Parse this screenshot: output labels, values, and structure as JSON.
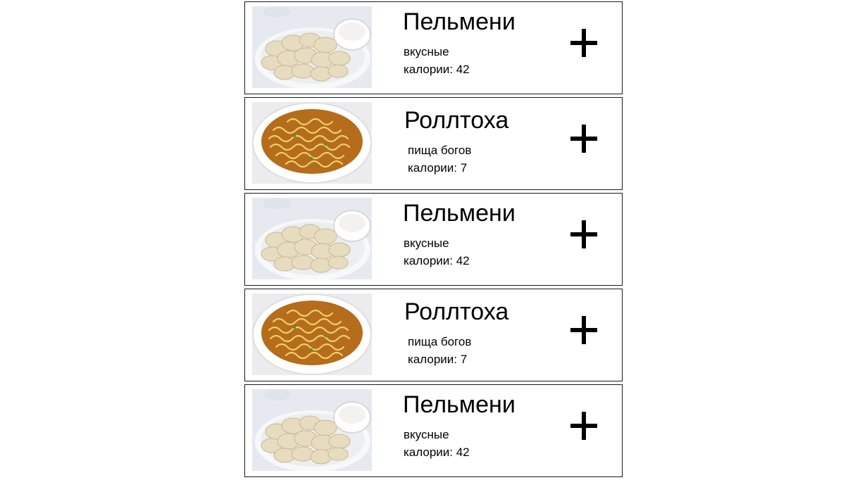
{
  "menu": {
    "items": [
      {
        "image": "pelmeni-photo",
        "title": "Пельмени",
        "description": "вкусные",
        "calories": "калории: 42",
        "add_icon": "plus-icon"
      },
      {
        "image": "noodles-photo",
        "title": "Роллтоха",
        "description": "пища богов",
        "calories": "калории: 7",
        "add_icon": "plus-icon"
      },
      {
        "image": "pelmeni-photo",
        "title": "Пельмени",
        "description": "вкусные",
        "calories": "калории: 42",
        "add_icon": "plus-icon"
      },
      {
        "image": "noodles-photo",
        "title": "Роллтоха",
        "description": "пища богов",
        "calories": "калории: 7",
        "add_icon": "plus-icon"
      },
      {
        "image": "pelmeni-photo",
        "title": "Пельмени",
        "description": "вкусные",
        "calories": "калории: 42",
        "add_icon": "plus-icon"
      }
    ]
  }
}
